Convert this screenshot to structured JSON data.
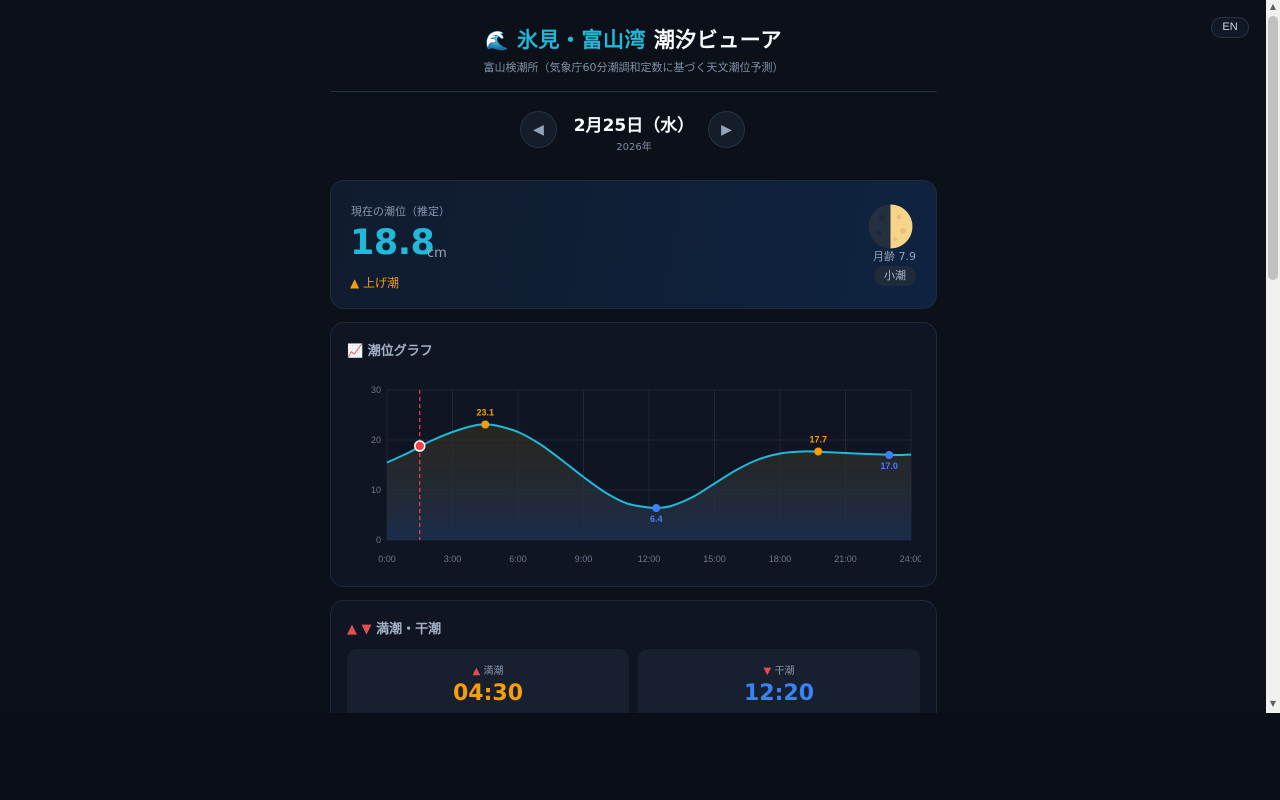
{
  "app": {
    "lang_button": "EN",
    "title_emoji": "🌊",
    "title_accent": "氷見・富山湾",
    "title_rest": "潮汐ビューア",
    "subtitle": "富山検潮所（気象庁60分潮調和定数に基づく天文潮位予測）"
  },
  "date_nav": {
    "prev_icon": "◀",
    "next_icon": "▶",
    "date": "2月25日（水）",
    "year": "2026年"
  },
  "current": {
    "label": "現在の潮位（推定）",
    "value": "18.8",
    "unit": "cm",
    "trend": "▲ 上げ潮",
    "moon_age": "月齢 7.9",
    "tide_type": "小潮"
  },
  "graph": {
    "heading": "📈 潮位グラフ"
  },
  "tides": {
    "heading_up": "▲",
    "heading_down": "▼",
    "heading": "満潮・干潮",
    "high": {
      "icon": "▲",
      "label": "満潮",
      "time": "04:30"
    },
    "low": {
      "icon": "▼",
      "label": "干潮",
      "time": "12:20"
    }
  },
  "colors": {
    "accent": "#22b8d8",
    "high": "#f59e0b",
    "low": "#3b82f6",
    "now_marker": "#ef4444"
  },
  "chart_data": {
    "type": "line",
    "x_unit": "hour",
    "xlim": [
      0,
      24
    ],
    "ylim": [
      0,
      30
    ],
    "x_ticks": [
      "0:00",
      "3:00",
      "6:00",
      "9:00",
      "12:00",
      "15:00",
      "18:00",
      "21:00",
      "24:00"
    ],
    "y_ticks": [
      "0",
      "10",
      "20",
      "30"
    ],
    "series": [
      {
        "x": [
          0,
          1,
          2,
          3,
          4,
          4.5,
          5,
          6,
          7,
          8,
          9,
          10,
          11,
          12,
          12.33,
          13,
          14,
          15,
          16,
          17,
          18,
          19,
          19.5,
          20,
          21,
          22,
          23,
          23.5,
          24
        ],
        "values": [
          15.5,
          17.5,
          19.8,
          21.6,
          22.9,
          23.1,
          22.9,
          21.6,
          19.2,
          16.0,
          12.6,
          9.5,
          7.3,
          6.5,
          6.4,
          6.8,
          8.6,
          11.3,
          14.0,
          16.1,
          17.3,
          17.7,
          17.7,
          17.6,
          17.4,
          17.2,
          17.05,
          17.0,
          17.1
        ]
      }
    ],
    "extrema": [
      {
        "kind": "high",
        "x": 4.5,
        "y": 23.1,
        "label": "23.1"
      },
      {
        "kind": "low",
        "x": 12.33,
        "y": 6.4,
        "label": "6.4"
      },
      {
        "kind": "high",
        "x": 19.75,
        "y": 17.7,
        "label": "17.7"
      },
      {
        "kind": "low",
        "x": 23.0,
        "y": 17.0,
        "label": "17.0"
      }
    ],
    "now": {
      "x": 1.5,
      "y": 18.8
    },
    "grid": true
  }
}
